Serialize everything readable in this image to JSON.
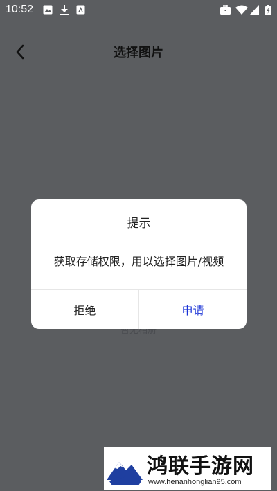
{
  "status_bar": {
    "time": "10:52",
    "left_icons": [
      "image-icon",
      "download-icon",
      "app-icon"
    ],
    "right_icons": [
      "briefcase-icon",
      "wifi-icon",
      "signal-icon",
      "battery-icon"
    ]
  },
  "header": {
    "title": "选择图片",
    "back_icon": "back-arrow-icon"
  },
  "background_label": "暂无相册",
  "dialog": {
    "title": "提示",
    "message": "获取存储权限，用以选择图片/视频",
    "refuse_label": "拒绝",
    "apply_label": "申请"
  },
  "watermark": {
    "title": "鸿联手游网",
    "url": "www.henanhonglian95.com"
  },
  "colors": {
    "overlay_background": "#5b5d60",
    "dialog_background": "#ffffff",
    "accent": "#1a33d6",
    "logo_blue": "#1f3fa0"
  }
}
